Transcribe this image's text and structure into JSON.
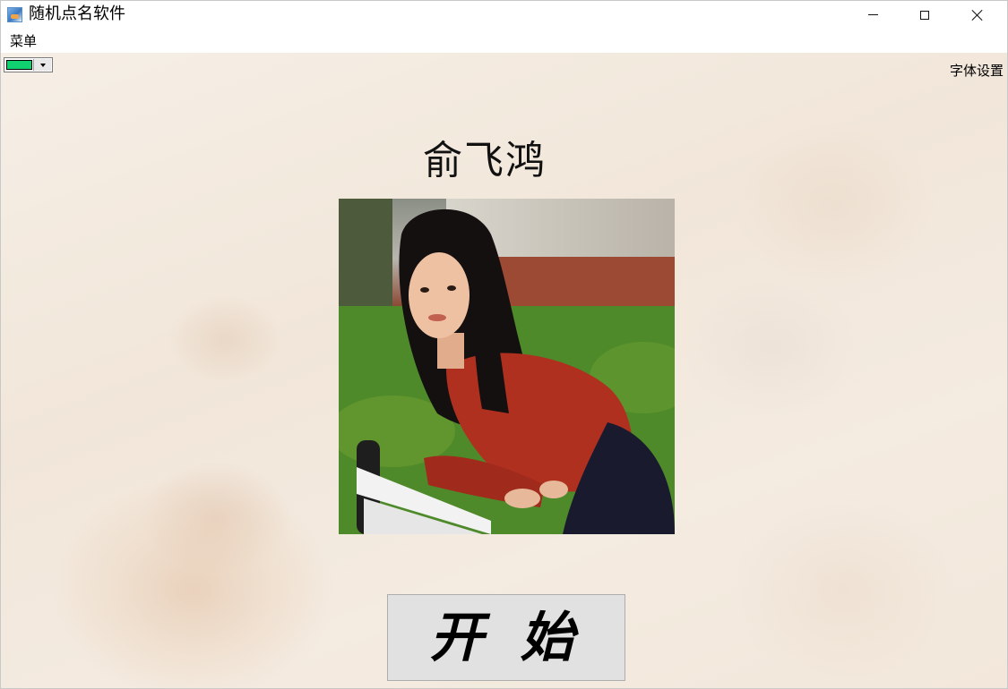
{
  "window": {
    "title": "随机点名软件"
  },
  "menubar": {
    "menu_label": "菜单"
  },
  "toolbar": {
    "color_value": "#10d070",
    "font_settings_label": "字体设置"
  },
  "main": {
    "student_name": "俞飞鸿",
    "start_button_label": "开 始"
  },
  "colors": {
    "swatch": "#10d070",
    "button_bg": "#e1e1e1"
  }
}
